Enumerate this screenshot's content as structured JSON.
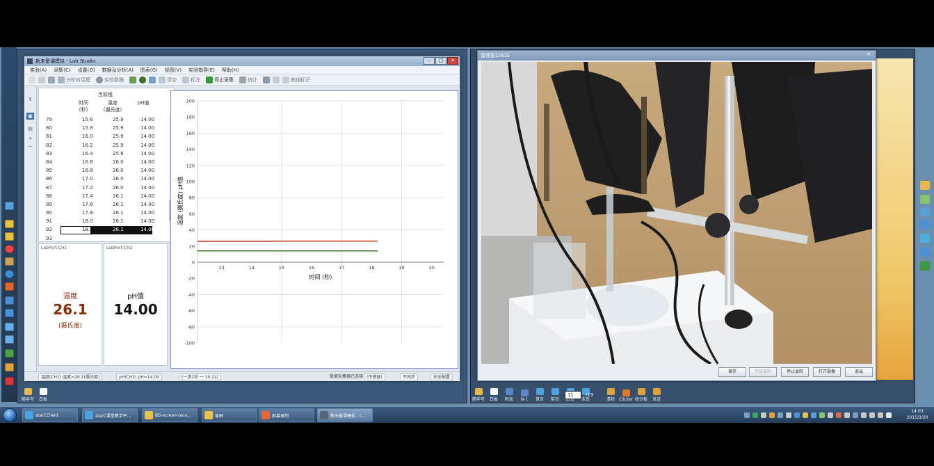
{
  "lab_window": {
    "title": "新未备课模拟 - Lab Studio",
    "menu": [
      "实验(A)",
      "采集(C)",
      "设置(O)",
      "数据及分析(A)",
      "图表(G)",
      "视图(V)",
      "实验指导(E)",
      "帮助(H)"
    ],
    "toolbar": [
      "分析对话框",
      "实验数据",
      "清空",
      "标注",
      "停止采集",
      "统计",
      "曲线标识"
    ],
    "side_buttons": [
      "↕",
      "▣",
      "▤",
      "+",
      "−"
    ],
    "table": {
      "title": "当前组",
      "headers": [
        {
          "line1": "时间",
          "line2": "(秒)"
        },
        {
          "line1": "温度",
          "line2": "(摄氏度)"
        },
        {
          "line1": "pH值",
          "line2": ""
        }
      ],
      "rows": [
        [
          "79",
          "15.6",
          "25.9",
          "14.00"
        ],
        [
          "80",
          "15.8",
          "25.9",
          "14.00"
        ],
        [
          "81",
          "16.0",
          "25.9",
          "14.00"
        ],
        [
          "82",
          "16.2",
          "25.9",
          "14.00"
        ],
        [
          "83",
          "16.4",
          "25.9",
          "14.00"
        ],
        [
          "84",
          "16.6",
          "26.0",
          "14.00"
        ],
        [
          "85",
          "16.8",
          "26.0",
          "14.00"
        ],
        [
          "86",
          "17.0",
          "26.0",
          "14.00"
        ],
        [
          "87",
          "17.2",
          "26.0",
          "14.00"
        ],
        [
          "88",
          "17.4",
          "26.1",
          "14.00"
        ],
        [
          "89",
          "17.6",
          "26.1",
          "14.00"
        ],
        [
          "90",
          "17.8",
          "26.1",
          "14.00"
        ],
        [
          "91",
          "18.0",
          "26.1",
          "14.00"
        ],
        [
          "92",
          "18.2",
          "26.1",
          "14.00"
        ]
      ],
      "partial_row": "93"
    },
    "meters": [
      {
        "label": "LabPort-CH1",
        "name": "温度",
        "value": "26.1",
        "unit": "(摄氏度)",
        "color": "#8b2d08"
      },
      {
        "label": "LabPort-CH2",
        "name": "pH值",
        "value": "14.00",
        "unit": "",
        "color": "#000000"
      }
    ],
    "status": [
      "温度(CH1) 温度=26.1(摄氏度)",
      "pH(CH2) pH=14.00",
      "(一滴1秒 一 10.2s)",
      "数据采集器已连接",
      "(传感器)",
      "不同步",
      "安全配置"
    ]
  },
  "chart_data": {
    "type": "line",
    "xlabel": "时间 (秒)",
    "ylabel": "温度 (摄氏度)   pH值",
    "xlim": [
      12.2,
      20.4
    ],
    "ylim": [
      -100,
      200
    ],
    "x_ticks": [
      "13",
      "14",
      "15",
      "16",
      "17",
      "18",
      "19",
      "20"
    ],
    "y_ticks": [
      "200",
      "180",
      "160",
      "140",
      "120",
      "100",
      "80",
      "60",
      "40",
      "20",
      "0",
      "-20",
      "-40",
      "-60",
      "-80",
      "-100"
    ],
    "grid": true,
    "series": [
      {
        "color": "#c0442a",
        "x": [
          12.2,
          14.4,
          14.8,
          18.2
        ],
        "y": [
          25.9,
          25.9,
          26.1,
          26.1
        ]
      },
      {
        "color": "#3a6a1e",
        "x": [
          12.2,
          18.2
        ],
        "y": [
          14.0,
          14.0
        ]
      }
    ]
  },
  "monitor": {
    "title": "监视窗口003",
    "buttons": [
      "保存",
      "开始录制",
      "停止录制",
      "打开摄像",
      "退出"
    ]
  },
  "left_tools": [
    {
      "label": "随手写",
      "color": "#e8b84a"
    },
    {
      "label": "白板",
      "color": "#ffffff"
    }
  ],
  "right_tools": [
    {
      "label": "随手写",
      "color": "#e8b84a"
    },
    {
      "label": "白板",
      "color": "#ffffff"
    },
    {
      "label": "附加",
      "color": "#5b86c4"
    },
    {
      "label": "N-1",
      "color": "#5b86c4"
    },
    {
      "label": "首页",
      "color": "#4da3e0"
    },
    {
      "label": "前页",
      "color": "#4da3e0"
    },
    {
      "label": "后页",
      "color": "#4da3e0"
    },
    {
      "label": "末页",
      "color": "#4da3e0"
    }
  ],
  "page_nav": {
    "current": "11",
    "total": "/19"
  },
  "right_tools2": [
    {
      "label": "清除",
      "color": "#e0a13a"
    },
    {
      "label": "Clicker",
      "color": "#e07a2a"
    },
    {
      "label": "统计板",
      "color": "#e0a13a"
    },
    {
      "label": "发送",
      "color": "#e0a13a"
    }
  ],
  "taskbar": {
    "tasks": [
      {
        "label": "starCClient",
        "color": "#4aa3e0"
      },
      {
        "label": "starC课堂教学平...",
        "color": "#4aa3e0"
      },
      {
        "label": "BD-screen-reco...",
        "color": "#e8c04a"
      },
      {
        "label": "录屏",
        "color": "#e8c04a"
      },
      {
        "label": "屏幕录制",
        "color": "#e86a3a"
      },
      {
        "label": "新未备课模拟 - L...",
        "color": "#556677"
      }
    ],
    "time": "14:03",
    "date": "2015/3/20"
  }
}
